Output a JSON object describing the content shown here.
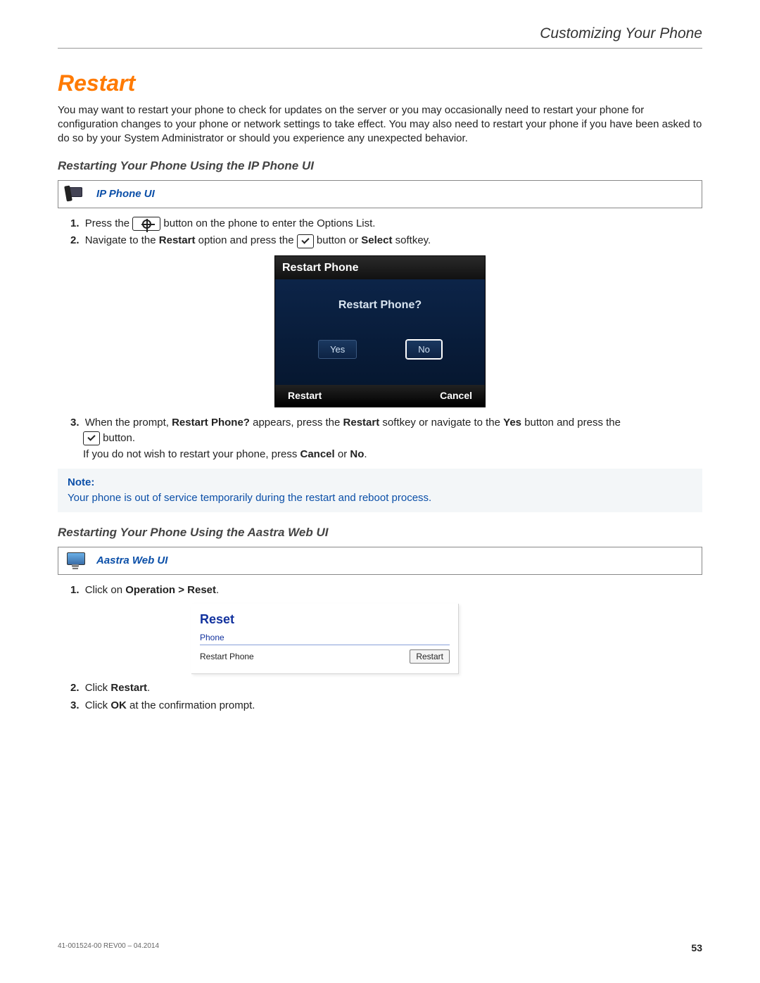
{
  "header": {
    "title": "Customizing Your Phone"
  },
  "section": {
    "title": "Restart",
    "intro": "You may want to restart your phone to check for updates on the server or you may occasionally need to restart your phone for configuration changes to your phone or network settings to take effect. You may also need to restart your phone if you have been asked to do so by your System Administrator or should you experience any unexpected behavior."
  },
  "ip": {
    "heading": "Restarting Your Phone Using the IP Phone UI",
    "box_label": "IP Phone UI",
    "step1": {
      "num": "1.",
      "a": "Press the",
      "b": "button on the phone to enter the Options List."
    },
    "step2": {
      "num": "2.",
      "a": "Navigate to the ",
      "restart": "Restart",
      "b": " option and press the ",
      "c": " button or ",
      "select": "Select",
      "d": " softkey."
    },
    "screen": {
      "title": "Restart Phone",
      "question": "Restart Phone?",
      "yes": "Yes",
      "no": "No",
      "soft_left": "Restart",
      "soft_right": "Cancel"
    },
    "step3": {
      "num": "3.",
      "a": "When the prompt, ",
      "prompt": "Restart Phone?",
      "b": " appears, press the ",
      "restart": "Restart",
      "c": " softkey or navigate to the ",
      "yes": "Yes",
      "d": " button and press the",
      "e": " button.",
      "f": "If you do not wish to restart your phone, press ",
      "cancel": "Cancel",
      "g": " or ",
      "no": "No",
      "h": "."
    }
  },
  "note": {
    "label": "Note:",
    "text": "Your phone is out of service temporarily during the restart and reboot process."
  },
  "web": {
    "heading": "Restarting Your Phone Using the Aastra Web UI",
    "box_label": "Aastra Web UI",
    "step1": {
      "num": "1.",
      "a": "Click on ",
      "op": "Operation > Reset",
      "b": "."
    },
    "ui": {
      "title": "Reset",
      "section": "Phone",
      "label": "Restart Phone",
      "button": "Restart"
    },
    "step2": {
      "num": "2.",
      "a": "Click ",
      "restart": "Restart",
      "b": "."
    },
    "step3": {
      "num": "3.",
      "a": "Click ",
      "ok": "OK",
      "b": " at the confirmation prompt."
    }
  },
  "footer": {
    "doc": "41-001524-00 REV00 – 04.2014",
    "page": "53"
  }
}
